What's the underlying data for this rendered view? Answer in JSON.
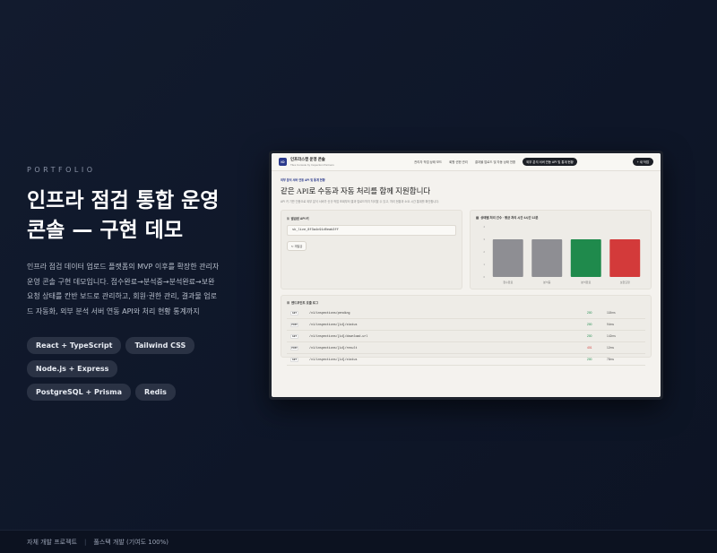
{
  "left": {
    "eyebrow": "PORTFOLIO",
    "title_line1": "인프라 점검 통합 운영",
    "title_line2": "콘솔 — 구현 데모",
    "description": "인프라 점검 데이터 업로드 플랫폼의 MVP 이후를 확장한 관리자 운영 콘솔 구현 데모입니다. 접수완료→분석중→분석완료→보완요청 상태를 칸반 보드로 관리하고, 회원·권한 관리, 결과물 업로드 자동화, 외부 분석 서버 연동 API와 처리 현황 통계까지",
    "tags": [
      "React + TypeScript",
      "Tailwind CSS",
      "Node.js + Express",
      "PostgreSQL + Prisma",
      "Redis"
    ]
  },
  "footer": {
    "left": "자체 개발 프로젝트",
    "right": "풀스택 개발 (기여도 100%)"
  },
  "app": {
    "logo": "IO",
    "brand_title": "인프라스캔 운영 콘솔",
    "brand_sub": "Tiles Console by Inspection Partners",
    "nav": [
      "관리자 작업 상태 보드",
      "회원·권한 관리",
      "결과물 업로드 및 자동 상태 전환",
      "외부 분석 서버 연동 API 및 통계 현황"
    ],
    "new_button": "+ 새 작업",
    "eyebrow": "외부 분석 서버 연동 API 및 통계 현황",
    "page_title": "같은 API로 수동과 자동 처리를 함께 지원합니다",
    "page_sub": "API 키 기반 인증으로 외부 분석 서버가 신규 작업 조회부터 결과 업로드까지 처리할 수 있고, 처리 현황과 소요 시간 통계를 확인합니다.",
    "key_card": {
      "title": "발급된 API 키",
      "key": "sk_live_8f3a4c91d0eab3ff",
      "reissue": "재발급"
    },
    "chart_card": {
      "title": "상태별 처리 건수 · 평균 처리 시간 4시간 12분"
    },
    "log_card": {
      "title": "엔드포인트 호출 로그",
      "rows": [
        {
          "method": "GET",
          "path": "/v1/inspections/pending",
          "status": "200",
          "ms": "118ms"
        },
        {
          "method": "POST",
          "path": "/v1/inspections/{id}/status",
          "status": "200",
          "ms": "94ms"
        },
        {
          "method": "GET",
          "path": "/v1/inspections/{id}/download-url",
          "status": "200",
          "ms": "142ms"
        },
        {
          "method": "POST",
          "path": "/v1/inspections/{id}/result",
          "status": "401",
          "ms": "12ms"
        },
        {
          "method": "GET",
          "path": "/v1/inspections/{id}/status",
          "status": "200",
          "ms": "78ms"
        }
      ]
    }
  },
  "chart_data": {
    "type": "bar",
    "categories": [
      "접수완료",
      "분석중",
      "분석완료",
      "보완요청"
    ],
    "values": [
      3,
      3,
      3,
      3
    ],
    "colors": [
      "#8e8e93",
      "#8e8e93",
      "#1f8a4c",
      "#d33a3a"
    ],
    "yticks": [
      0,
      1,
      2,
      3,
      4
    ],
    "ylim": [
      0,
      4
    ]
  }
}
